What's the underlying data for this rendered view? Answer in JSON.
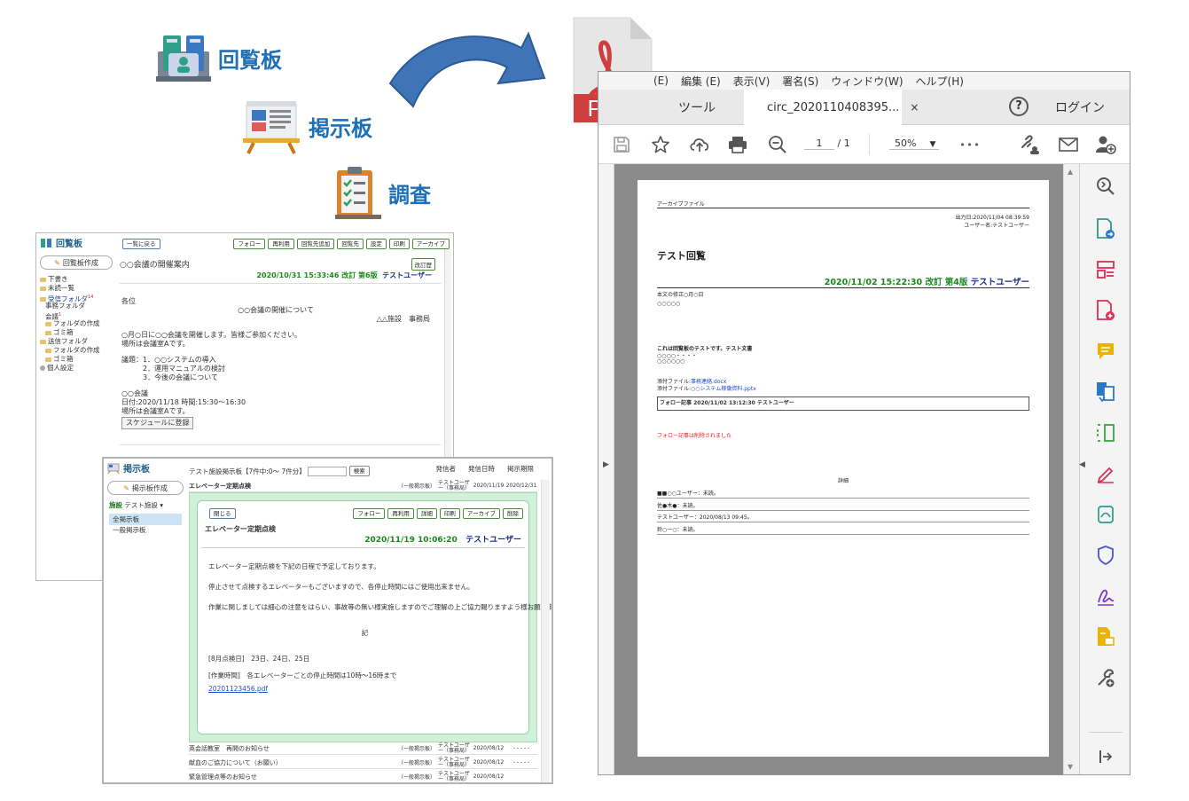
{
  "features": {
    "circular": "回覧板",
    "board": "掲示板",
    "survey": "調査"
  },
  "pdf_icon": {
    "label": "PDF",
    "color": "#cf3d3d"
  },
  "circ_window": {
    "app_title": "回覧板",
    "create_button": "回覧板作成",
    "tree": {
      "draft": "下書き",
      "unread": "未読一覧",
      "inbox": "受信フォルダ",
      "inbox_badge": "14",
      "office_folder": "事務フォルダ",
      "meeting": "会議",
      "meeting_badge": "1",
      "create_folder_1": "フォルダの作成",
      "trash_1": "ゴミ箱",
      "outbox": "送信フォルダ",
      "create_folder_2": "フォルダの作成",
      "trash_2": "ゴミ箱",
      "personal": "個人設定"
    },
    "back_button": "一覧に戻る",
    "toolbar": [
      "フォロー",
      "再利用",
      "回覧先追加",
      "回覧先",
      "設定",
      "印刷",
      "アーカイブ"
    ],
    "revise_button": "改訂歴",
    "title": "○○会議の開催案内",
    "meta_date": "2020/10/31 15:33:46 改訂 第6版",
    "meta_user": "テストユーザー",
    "body": {
      "to": "各位",
      "heading": "○○会議の開催について",
      "sender": "△△施設　事務局",
      "line1": "○月○日に○○会議を開催します。皆様ご参加ください。",
      "line2": "場所は会議室Aです。",
      "agenda1": "議題：1．○○システムの導入",
      "agenda2": "　　　2．運用マニュアルの検討",
      "agenda3": "　　　3．今後の会議について",
      "event": "○○会議",
      "datetime": "日付:2020/11/18 時間:15:30～16:30",
      "place": "場所は会議室Aです。",
      "schedule_button": "スケジュールに登録"
    }
  },
  "board_window": {
    "app_title": "掲示板",
    "create_button": "掲示板作成",
    "facility_label": "施設",
    "facility_value": "テスト施設",
    "menu_all": "全掲示板",
    "menu_general": "一般掲示板",
    "list_header": "テスト施設掲示板【7件中:0～ 7件分】",
    "search_button": "検索",
    "columns": {
      "sender": "発信者",
      "datetime": "発信日時",
      "period": "掲示期限"
    },
    "top_row": {
      "title": "エレベーター定期点検",
      "kind": "（一般掲示板）",
      "sender": "テストユーザー（事務局）",
      "date": "2020/11/19",
      "end": "2020/12/31"
    },
    "detail": {
      "close_button": "閉じる",
      "buttons": [
        "フォロー",
        "再利用",
        "詳細",
        "印刷",
        "アーカイブ",
        "削除"
      ],
      "title": "エレベーター定期点検",
      "meta_date": "2020/11/19 10:06:20",
      "meta_user": "テストユーザー",
      "p1": "エレベーター定期点検を下記の日程で予定しております。",
      "p2": "停止させて点検するエレベーターもございますので、各停止時間にはご使用出来ません。",
      "p3": "作業に関しましては細心の注意をはらい、事故等の無い様実施しますのでご理解の上ご協力賜りますよう様お願い申し上げます。",
      "ki": "記",
      "days": "[8月点検日]　23日、24日、25日",
      "hours": "[作業時間]　各エレベーターごとの停止時間は10時～16時まで",
      "attachment": "20201123456.pdf"
    },
    "rows": [
      {
        "title": "英会話教室　再開のお知らせ",
        "kind": "（一般掲示板）",
        "sender": "テストユーザー（事務局）",
        "date": "2020/08/12",
        "end": "- - - - -"
      },
      {
        "title": "献血のご協力について（お願い）",
        "kind": "（一般掲示板）",
        "sender": "テストユーザー（事務局）",
        "date": "2020/08/12",
        "end": "- - - - -"
      },
      {
        "title": "緊急管理点等のお知らせ",
        "kind": "（一般掲示板）",
        "sender": "テストユーザー（事務局）",
        "date": "2020/08/12",
        "end": ""
      }
    ]
  },
  "pdf_window": {
    "menu": [
      "(E)",
      "編集 (E)",
      "表示(V)",
      "署名(S)",
      "ウィンドウ(W)",
      "ヘルプ(H)"
    ],
    "tab_tool": "ツール",
    "tab_doc": "circ_2020110408395...",
    "tab_close": "×",
    "help": "?",
    "login": "ログイン",
    "page_current": "1",
    "page_total": "/ 1",
    "zoom": "50%",
    "more": "• • •",
    "page": {
      "header": "アーカイブファイル",
      "output_date": "出力日:2020/11/04 08:39:59",
      "user_name": "ユーザー名:テストユーザー",
      "title": "テスト回覧",
      "meta_date": "2020/11/02 15:22:30 改訂 第4版",
      "meta_user": "テストユーザー",
      "revision_label": "本文の修正○月○日",
      "revision_text": "○○○○○",
      "body1": "これは回覧板のテストです。テスト文書",
      "body2": "○○○○・・・・",
      "body3": "○○○○○○",
      "attach1_label": "添付ファイル:",
      "attach1_file": "事務連絡.docx",
      "attach2_label": "添付ファイル:",
      "attach2_file": "○○システム稼働資料.pptx",
      "follow_box": "フォロー記事 2020/11/02 13:12:30 テストユーザー",
      "follow_deleted": "フォロー記事は削除されました",
      "detail_heading": "詳細",
      "detail_rows": [
        "■■○○ユーザー：未読。",
        "佐●木●：未読。",
        "テストユーザー：2020/08/13 09:45。",
        "鈴○一○：未読。"
      ]
    }
  },
  "colors": {
    "accent_blue": "#1f6fb5",
    "arrow_blue": "#3f74b8",
    "pdf_red": "#cf3d3d",
    "green_meta": "#1a8a1a",
    "navy_meta": "#1a2a8a",
    "board_highlight": "#cff1d9"
  }
}
